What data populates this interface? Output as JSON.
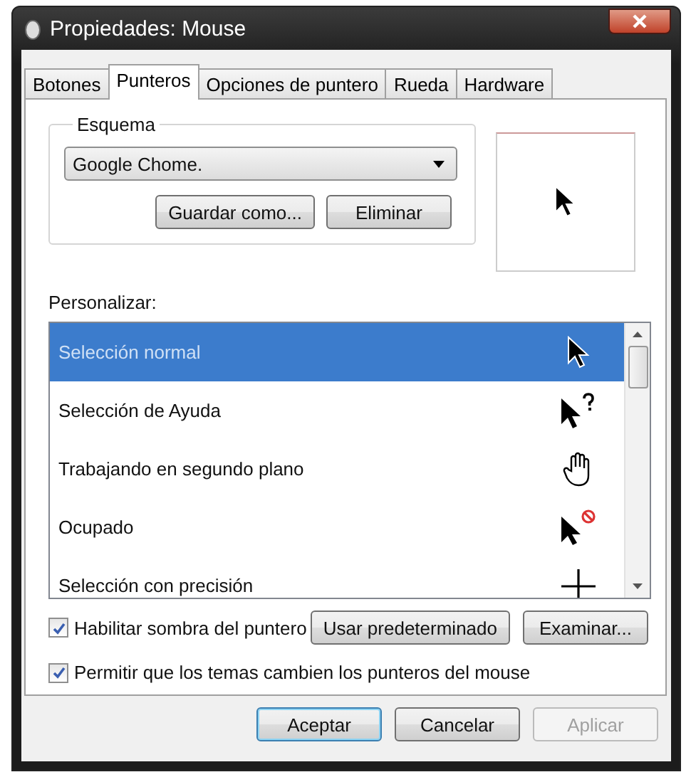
{
  "window": {
    "title": "Propiedades: Mouse"
  },
  "tabs": [
    {
      "label": "Botones",
      "selected": false
    },
    {
      "label": "Punteros",
      "selected": true
    },
    {
      "label": "Opciones de puntero",
      "selected": false
    },
    {
      "label": "Rueda",
      "selected": false
    },
    {
      "label": "Hardware",
      "selected": false
    }
  ],
  "scheme": {
    "legend": "Esquema",
    "value": "Google Chome.",
    "buttons": [
      "Guardar como...",
      "Eliminar"
    ]
  },
  "customize": {
    "label": "Personalizar:",
    "items": [
      {
        "name": "Selección normal",
        "kind": "arrow",
        "selected": true
      },
      {
        "name": "Selección de Ayuda",
        "kind": "help",
        "selected": false
      },
      {
        "name": "Trabajando en segundo plano",
        "kind": "hand",
        "selected": false
      },
      {
        "name": "Ocupado",
        "kind": "busy",
        "selected": false
      },
      {
        "name": "Selección con precisión",
        "kind": "cross",
        "selected": false
      }
    ]
  },
  "options": [
    {
      "label": "Habilitar sombra del puntero",
      "checked": true
    },
    {
      "label": "Permitir que los temas cambien los punteros del mouse",
      "checked": true
    }
  ],
  "pointer_buttons": [
    "Usar predeterminado",
    "Examinar..."
  ],
  "dialog_buttons": [
    {
      "label": "Aceptar",
      "default": true,
      "disabled": false
    },
    {
      "label": "Cancelar",
      "default": false,
      "disabled": false
    },
    {
      "label": "Aplicar",
      "default": false,
      "disabled": true
    }
  ]
}
